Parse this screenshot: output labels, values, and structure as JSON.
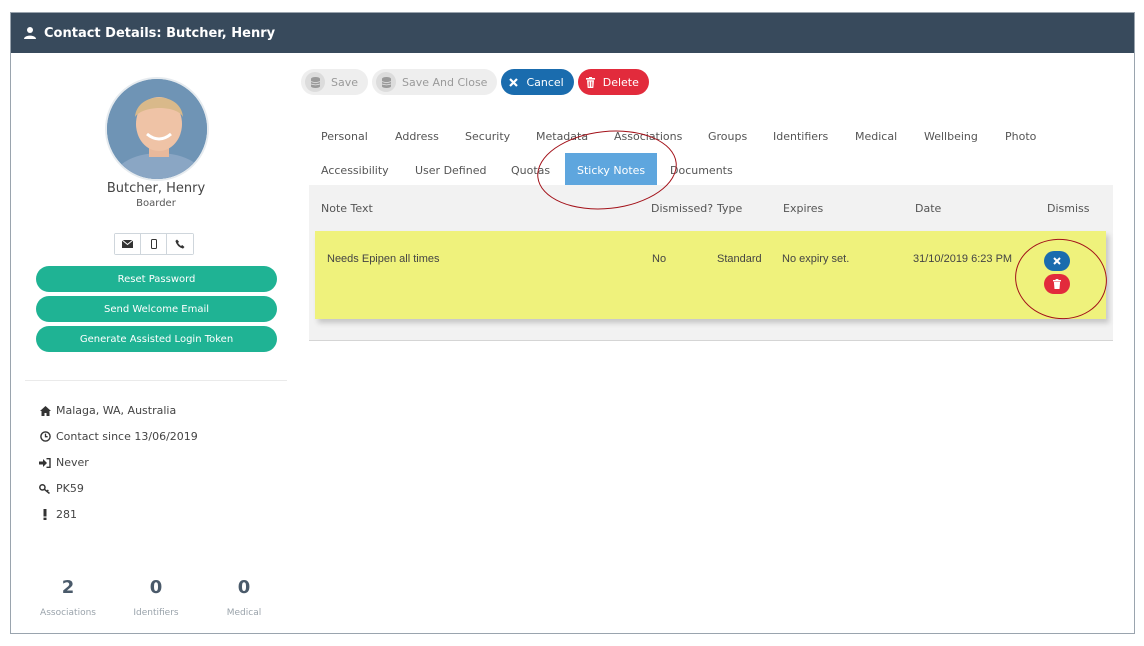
{
  "window": {
    "title": "Contact Details: Butcher, Henry"
  },
  "profile": {
    "name": "Butcher, Henry",
    "role": "Boarder",
    "contact_icons": [
      "email-icon",
      "mobile-icon",
      "phone-icon"
    ],
    "buttons": {
      "reset_password": "Reset Password",
      "send_welcome": "Send Welcome Email",
      "assisted_login": "Generate Assisted Login Token"
    },
    "info": {
      "location": "Malaga, WA, Australia",
      "contact_since": "Contact since 13/06/2019",
      "last_login": "Never",
      "code": "PK59",
      "alert_id": "281"
    },
    "stats": [
      {
        "value": "2",
        "label": "Associations"
      },
      {
        "value": "0",
        "label": "Identifiers"
      },
      {
        "value": "0",
        "label": "Medical"
      }
    ]
  },
  "toolbar": {
    "save": "Save",
    "save_close": "Save And Close",
    "cancel": "Cancel",
    "delete": "Delete"
  },
  "tabs": {
    "row1": [
      "Personal",
      "Address",
      "Security",
      "Metadata",
      "Associations",
      "Groups",
      "Identifiers",
      "Medical",
      "Wellbeing",
      "Photo"
    ],
    "row2": [
      "Accessibility",
      "User Defined",
      "Quotas",
      "Sticky Notes",
      "Documents"
    ],
    "active": "Sticky Notes"
  },
  "grid": {
    "headers": {
      "note_text": "Note Text",
      "dismissed": "Dismissed?",
      "type": "Type",
      "expires": "Expires",
      "date": "Date",
      "dismiss": "Dismiss"
    },
    "rows": [
      {
        "note_text": "Needs Epipen all times",
        "dismissed": "No",
        "type": "Standard",
        "expires": "No expiry set.",
        "date": "31/10/2019 6:23 PM"
      }
    ]
  },
  "colors": {
    "header_bg": "#384a5c",
    "green_button": "#1fb394",
    "cancel_blue": "#1a6cae",
    "delete_red": "#e22b3c",
    "active_tab": "#5ea6de",
    "sticky_note_yellow": "#eff27c",
    "annotation_red": "#a3121a"
  }
}
